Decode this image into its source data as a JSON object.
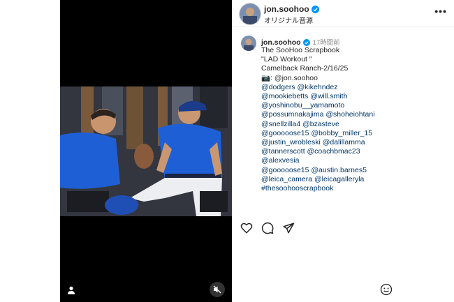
{
  "header": {
    "username": "jon.soohoo",
    "audio": "オリジナル音源",
    "more_label": "•••"
  },
  "post": {
    "username": "jon.soohoo",
    "time_ago": "17時間前",
    "caption_lines": [
      "The SooHoo Scrapbook",
      "\"LAD Workout \"",
      "Camelback Ranch-2/16/25",
      "📷: @jon.soohoo",
      "@dodgers @kikehndez",
      "@mookiebetts @will.smith",
      "@yoshinobu__yamamoto",
      "@possumnakajima @shoheiohtani",
      "@snellzilla4 @bzasteve",
      "@gooooose15 @bobby_miller_15",
      "@justin_wrobleski @dalillamma",
      "@tannerscott @coachbmac23",
      "@alexvesia",
      "@gooooose15 @austin.barnes5",
      "@leica_camera @leicagalleryla",
      "#thesoohooscrapbook"
    ]
  },
  "icons": {
    "like": "heart-icon",
    "comment": "comment-icon",
    "share": "send-icon",
    "mute": "speaker-muted-icon",
    "tagged": "user-icon",
    "emoji": "emoji-icon",
    "verified": "verified-badge-icon"
  },
  "colors": {
    "verified": "#0095f6",
    "link": "#00376b",
    "jersey": "#1f5fd6"
  }
}
